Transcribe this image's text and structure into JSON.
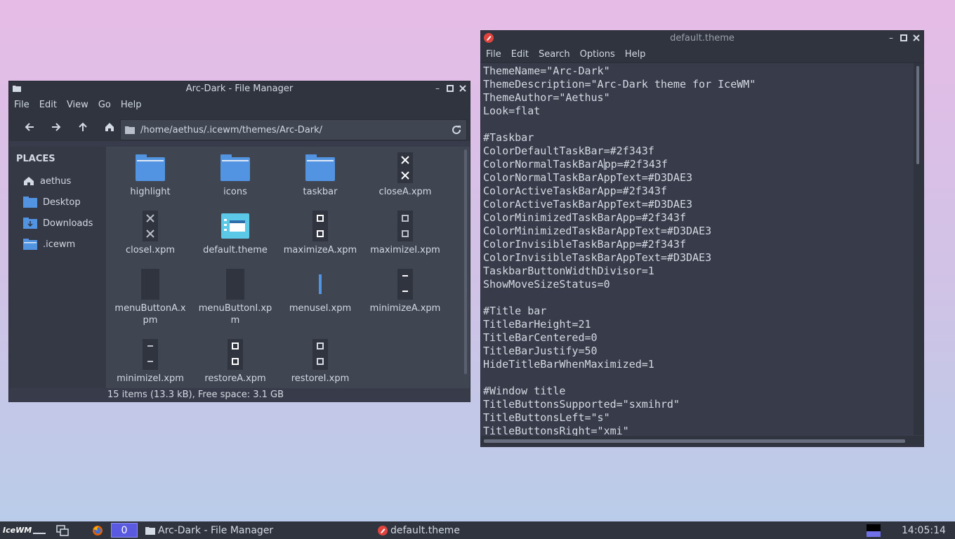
{
  "file_manager": {
    "title": "Arc-Dark - File Manager",
    "menu": [
      "File",
      "Edit",
      "View",
      "Go",
      "Help"
    ],
    "path": "/home/aethus/.icewm/themes/Arc-Dark/",
    "places_heading": "PLACES",
    "places": [
      {
        "label": "aethus",
        "icon": "home-icon"
      },
      {
        "label": "Desktop",
        "icon": "desktop-folder-icon"
      },
      {
        "label": "Downloads",
        "icon": "downloads-folder-icon"
      },
      {
        "label": ".icewm",
        "icon": "folder-icon"
      }
    ],
    "items": [
      {
        "label": "highlight",
        "icon": "folder-icon"
      },
      {
        "label": "icons",
        "icon": "folder-icon"
      },
      {
        "label": "taskbar",
        "icon": "folder-icon"
      },
      {
        "label": "closeA.xpm",
        "icon": "close-xpm-icon"
      },
      {
        "label": "closeI.xpm",
        "icon": "close-xpm-icon"
      },
      {
        "label": "default.theme",
        "icon": "theme-file-icon"
      },
      {
        "label": "maximizeA.xpm",
        "icon": "maximize-xpm-icon"
      },
      {
        "label": "maximizeI.xpm",
        "icon": "maximize-xpm-icon"
      },
      {
        "label": "menuButtonA.xpm",
        "icon": "menu-button-xpm-icon"
      },
      {
        "label": "menuButtonI.xpm",
        "icon": "menu-button-xpm-icon"
      },
      {
        "label": "menusel.xpm",
        "icon": "menusel-xpm-icon"
      },
      {
        "label": "minimizeA.xpm",
        "icon": "minimize-xpm-icon"
      },
      {
        "label": "minimizeI.xpm",
        "icon": "minimize-xpm-icon"
      },
      {
        "label": "restoreA.xpm",
        "icon": "restore-xpm-icon"
      },
      {
        "label": "restoreI.xpm",
        "icon": "restore-xpm-icon"
      }
    ],
    "status": "15 items (13.3 kB), Free space: 3.1 GB"
  },
  "editor": {
    "title": "default.theme",
    "menu": [
      "File",
      "Edit",
      "Search",
      "Options",
      "Help"
    ],
    "lines": [
      "ThemeName=\"Arc-Dark\"",
      "ThemeDescription=\"Arc-Dark theme for IceWM\"",
      "ThemeAuthor=\"Aethus\"",
      "Look=flat",
      "",
      "#Taskbar",
      "ColorDefaultTaskBar=#2f343f",
      "ColorNormalTaskBarApp=#2f343f",
      "ColorNormalTaskBarAppText=#D3DAE3",
      "ColorActiveTaskBarApp=#2f343f",
      "ColorActiveTaskBarAppText=#D3DAE3",
      "ColorMinimizedTaskBarApp=#2f343f",
      "ColorMinimizedTaskBarAppText=#D3DAE3",
      "ColorInvisibleTaskBarApp=#2f343f",
      "ColorInvisibleTaskBarAppText=#D3DAE3",
      "TaskbarButtonWidthDivisor=1",
      "ShowMoveSizeStatus=0",
      "",
      "#Title bar",
      "TitleBarHeight=21",
      "TitleBarCentered=0",
      "TitleBarJustify=50",
      "HideTitleBarWhenMaximized=1",
      "",
      "#Window title",
      "TitleButtonsSupported=\"sxmihrd\"",
      "TitleButtonsLeft=\"s\"",
      "TitleButtonsRight=\"xmi\""
    ]
  },
  "taskbar": {
    "logo": "IceWM",
    "workspace": "0",
    "tasks": [
      {
        "label": "Arc-Dark - File Manager",
        "icon": "folder-icon"
      },
      {
        "label": "default.theme",
        "icon": "editor-icon"
      }
    ],
    "clock": "14:05:14"
  },
  "colors": {
    "window_bg": "#383c4a",
    "titlebar_bg": "#2f343f",
    "text": "#d3dae3",
    "folder_blue": "#5294e2"
  }
}
